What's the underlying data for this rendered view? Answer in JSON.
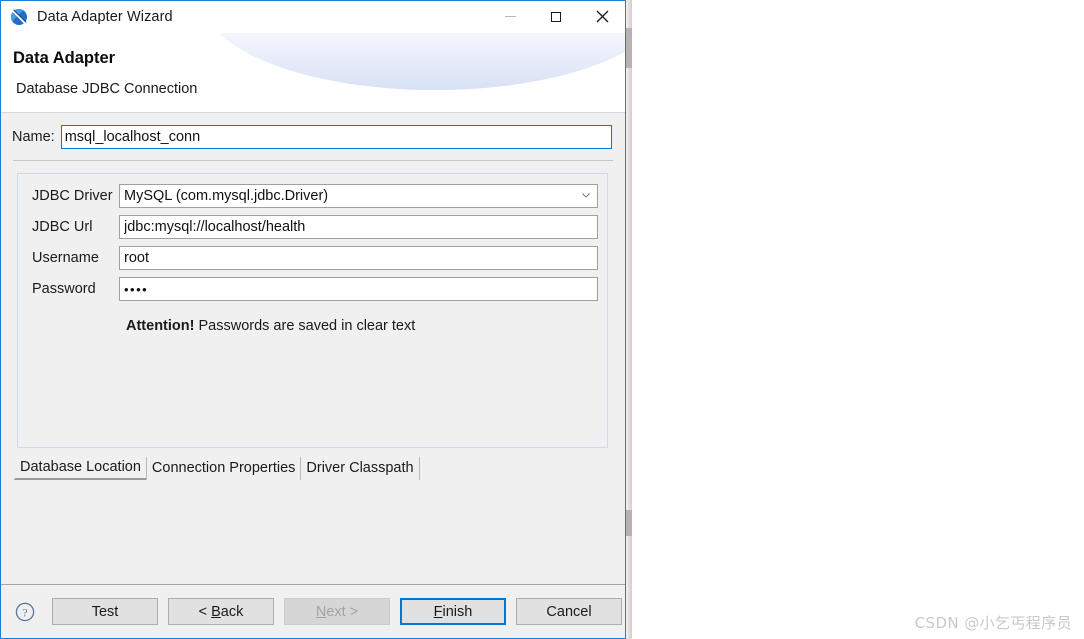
{
  "window": {
    "title": "Data Adapter Wizard",
    "icon": "data-adapter-icon",
    "controls": {
      "minimize": "minimize-icon",
      "maximize": "maximize-icon",
      "close": "close-icon"
    }
  },
  "header": {
    "title": "Data Adapter",
    "subtitle": "Database JDBC Connection"
  },
  "name_field": {
    "label": "Name:",
    "value": "msql_localhost_conn",
    "placeholder": ""
  },
  "form": {
    "rows": [
      {
        "label": "JDBC Driver",
        "value": "MySQL (com.mysql.jdbc.Driver)",
        "type": "combobox"
      },
      {
        "label": "JDBC Url",
        "value": "jdbc:mysql://localhost/health",
        "type": "text"
      },
      {
        "label": "Username",
        "value": "root",
        "type": "text"
      },
      {
        "label": "Password",
        "value": "••••",
        "type": "password"
      }
    ],
    "attention_bold": "Attention!",
    "attention_text": " Passwords are saved in clear text"
  },
  "tabs": [
    {
      "label": "Database Location",
      "selected": true
    },
    {
      "label": "Connection Properties",
      "selected": false
    },
    {
      "label": "Driver Classpath",
      "selected": false
    }
  ],
  "footer": {
    "help": "help-icon",
    "buttons": [
      {
        "label": "Test",
        "state": "enabled",
        "mnemonic": ""
      },
      {
        "label": "< Back",
        "state": "enabled",
        "mnemonic": "B"
      },
      {
        "label": "Next >",
        "state": "disabled",
        "mnemonic": "N"
      },
      {
        "label": "Finish",
        "state": "default",
        "mnemonic": "F"
      },
      {
        "label": "Cancel",
        "state": "enabled",
        "mnemonic": ""
      }
    ]
  },
  "watermark": {
    "text": "CSDN @小乞丐程序员"
  },
  "colors": {
    "accent": "#0078d7",
    "panel": "#f0f0f0",
    "border": "#a0a0a0",
    "disabled_text": "#a4a4a4"
  }
}
